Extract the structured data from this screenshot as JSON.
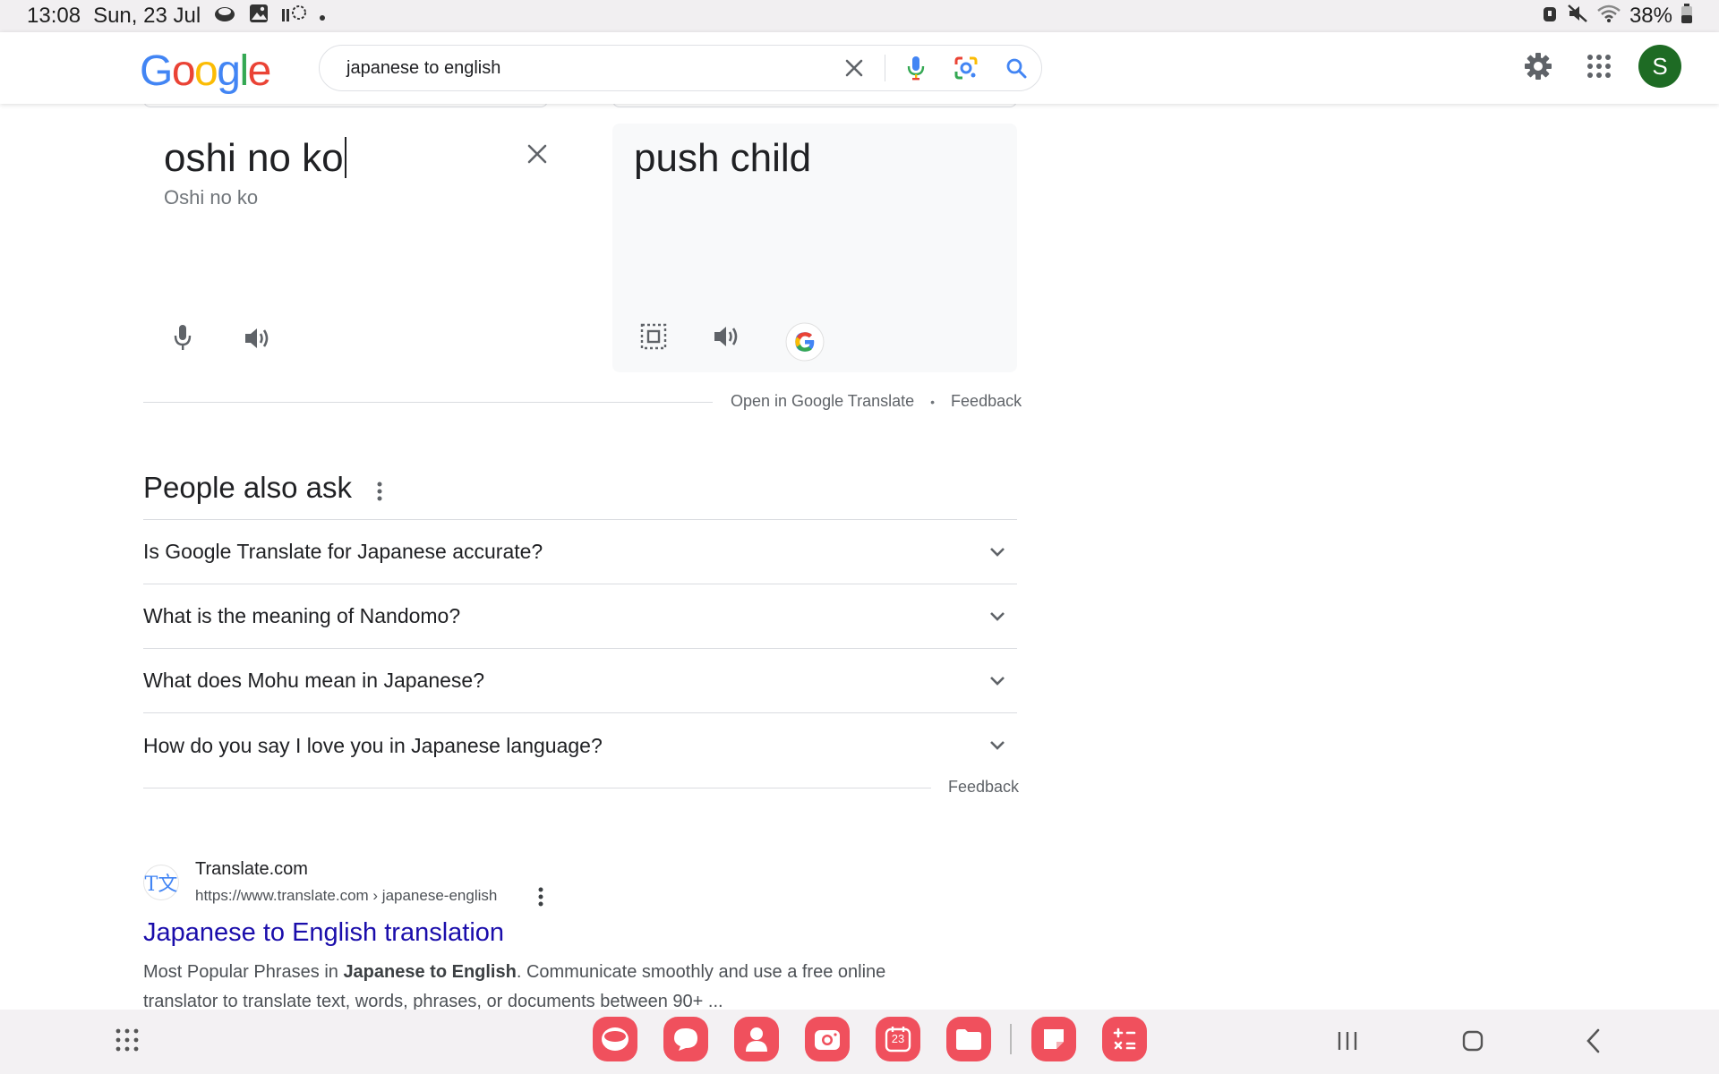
{
  "status_bar": {
    "time": "13:08",
    "date": "Sun, 23 Jul",
    "battery": "38%",
    "left_icons": [
      "game-launcher-icon",
      "gallery-icon",
      "nfc-icon",
      "dot-icon"
    ],
    "right_icons": [
      "alarm-icon",
      "mute-icon",
      "wifi-icon",
      "battery-icon"
    ]
  },
  "header": {
    "logo": {
      "letters": [
        "G",
        "o",
        "o",
        "g",
        "l",
        "e"
      ],
      "colors": [
        "#4285F4",
        "#EA4335",
        "#FBBC05",
        "#4285F4",
        "#34A853",
        "#EA4335"
      ]
    },
    "search": {
      "query": "japanese to english"
    },
    "avatar_letter": "S",
    "avatar_color": "#1e6b24"
  },
  "translate": {
    "source_text": "oshi no ko",
    "source_romanization": "Oshi no ko",
    "target_text": "push child",
    "open_link": "Open in Google Translate",
    "separator": "•",
    "feedback": "Feedback"
  },
  "people_also_ask": {
    "title": "People also ask",
    "questions": [
      "Is Google Translate for Japanese accurate?",
      "What is the meaning of Nandomo?",
      "What does Mohu mean in Japanese?",
      "How do you say I love you in Japanese language?"
    ],
    "feedback": "Feedback"
  },
  "result": {
    "favicon_text": "T文",
    "site_name": "Translate.com",
    "url": "https://www.translate.com › japanese-english",
    "title": "Japanese to English translation",
    "snippet_pre": "Most Popular Phrases in ",
    "snippet_bold": "Japanese to English",
    "snippet_post": ". Communicate smoothly and use a free online translator to translate text, words, phrases, or documents between 90+ ..."
  },
  "taskbar": {
    "apps": [
      "internet-browser",
      "messages",
      "contacts",
      "camera",
      "calendar",
      "my-files",
      "samsung-notes",
      "calculator"
    ],
    "calendar_day": "23",
    "accent": "#f0505d"
  }
}
